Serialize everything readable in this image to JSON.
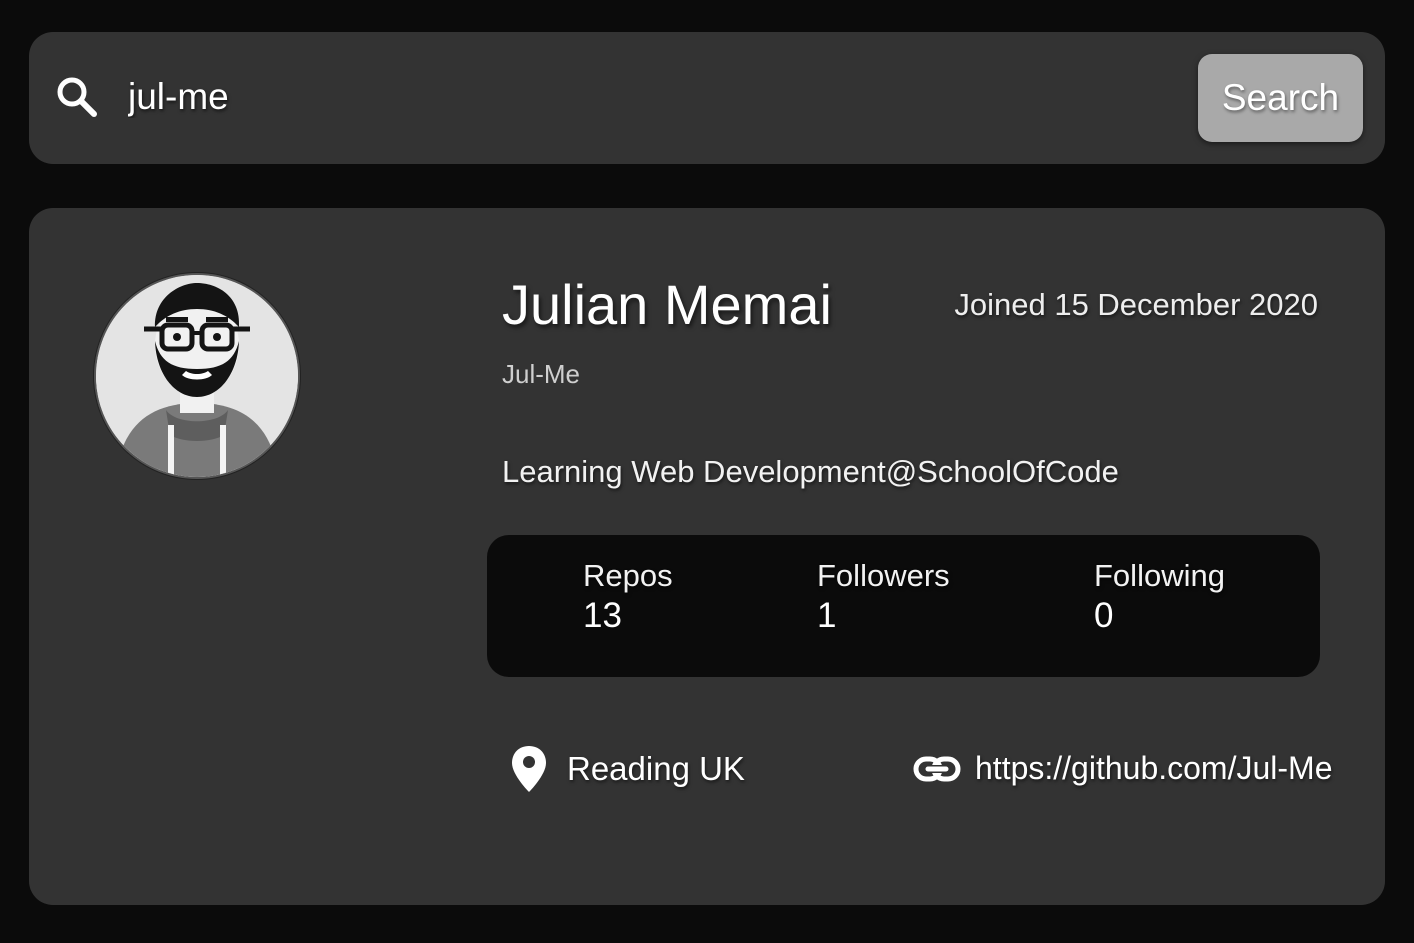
{
  "search": {
    "value": "jul-me",
    "button_label": "Search",
    "icon": "search-icon"
  },
  "profile": {
    "name": "Julian Memai",
    "joined": "Joined 15 December 2020",
    "login": "Jul-Me",
    "bio": "Learning Web Development@SchoolOfCode",
    "avatar_icon": "avatar-illustration",
    "stats": [
      {
        "label": "Repos",
        "value": "13"
      },
      {
        "label": "Followers",
        "value": "1"
      },
      {
        "label": "Following",
        "value": "0"
      }
    ],
    "location": "Reading UK",
    "location_icon": "map-pin-icon",
    "blog": "https://github.com/Jul-Me",
    "blog_icon": "link-icon"
  },
  "colors": {
    "background": "#0b0b0b",
    "card": "#333333",
    "button": "#a9a9a9",
    "text": "#ffffff"
  }
}
